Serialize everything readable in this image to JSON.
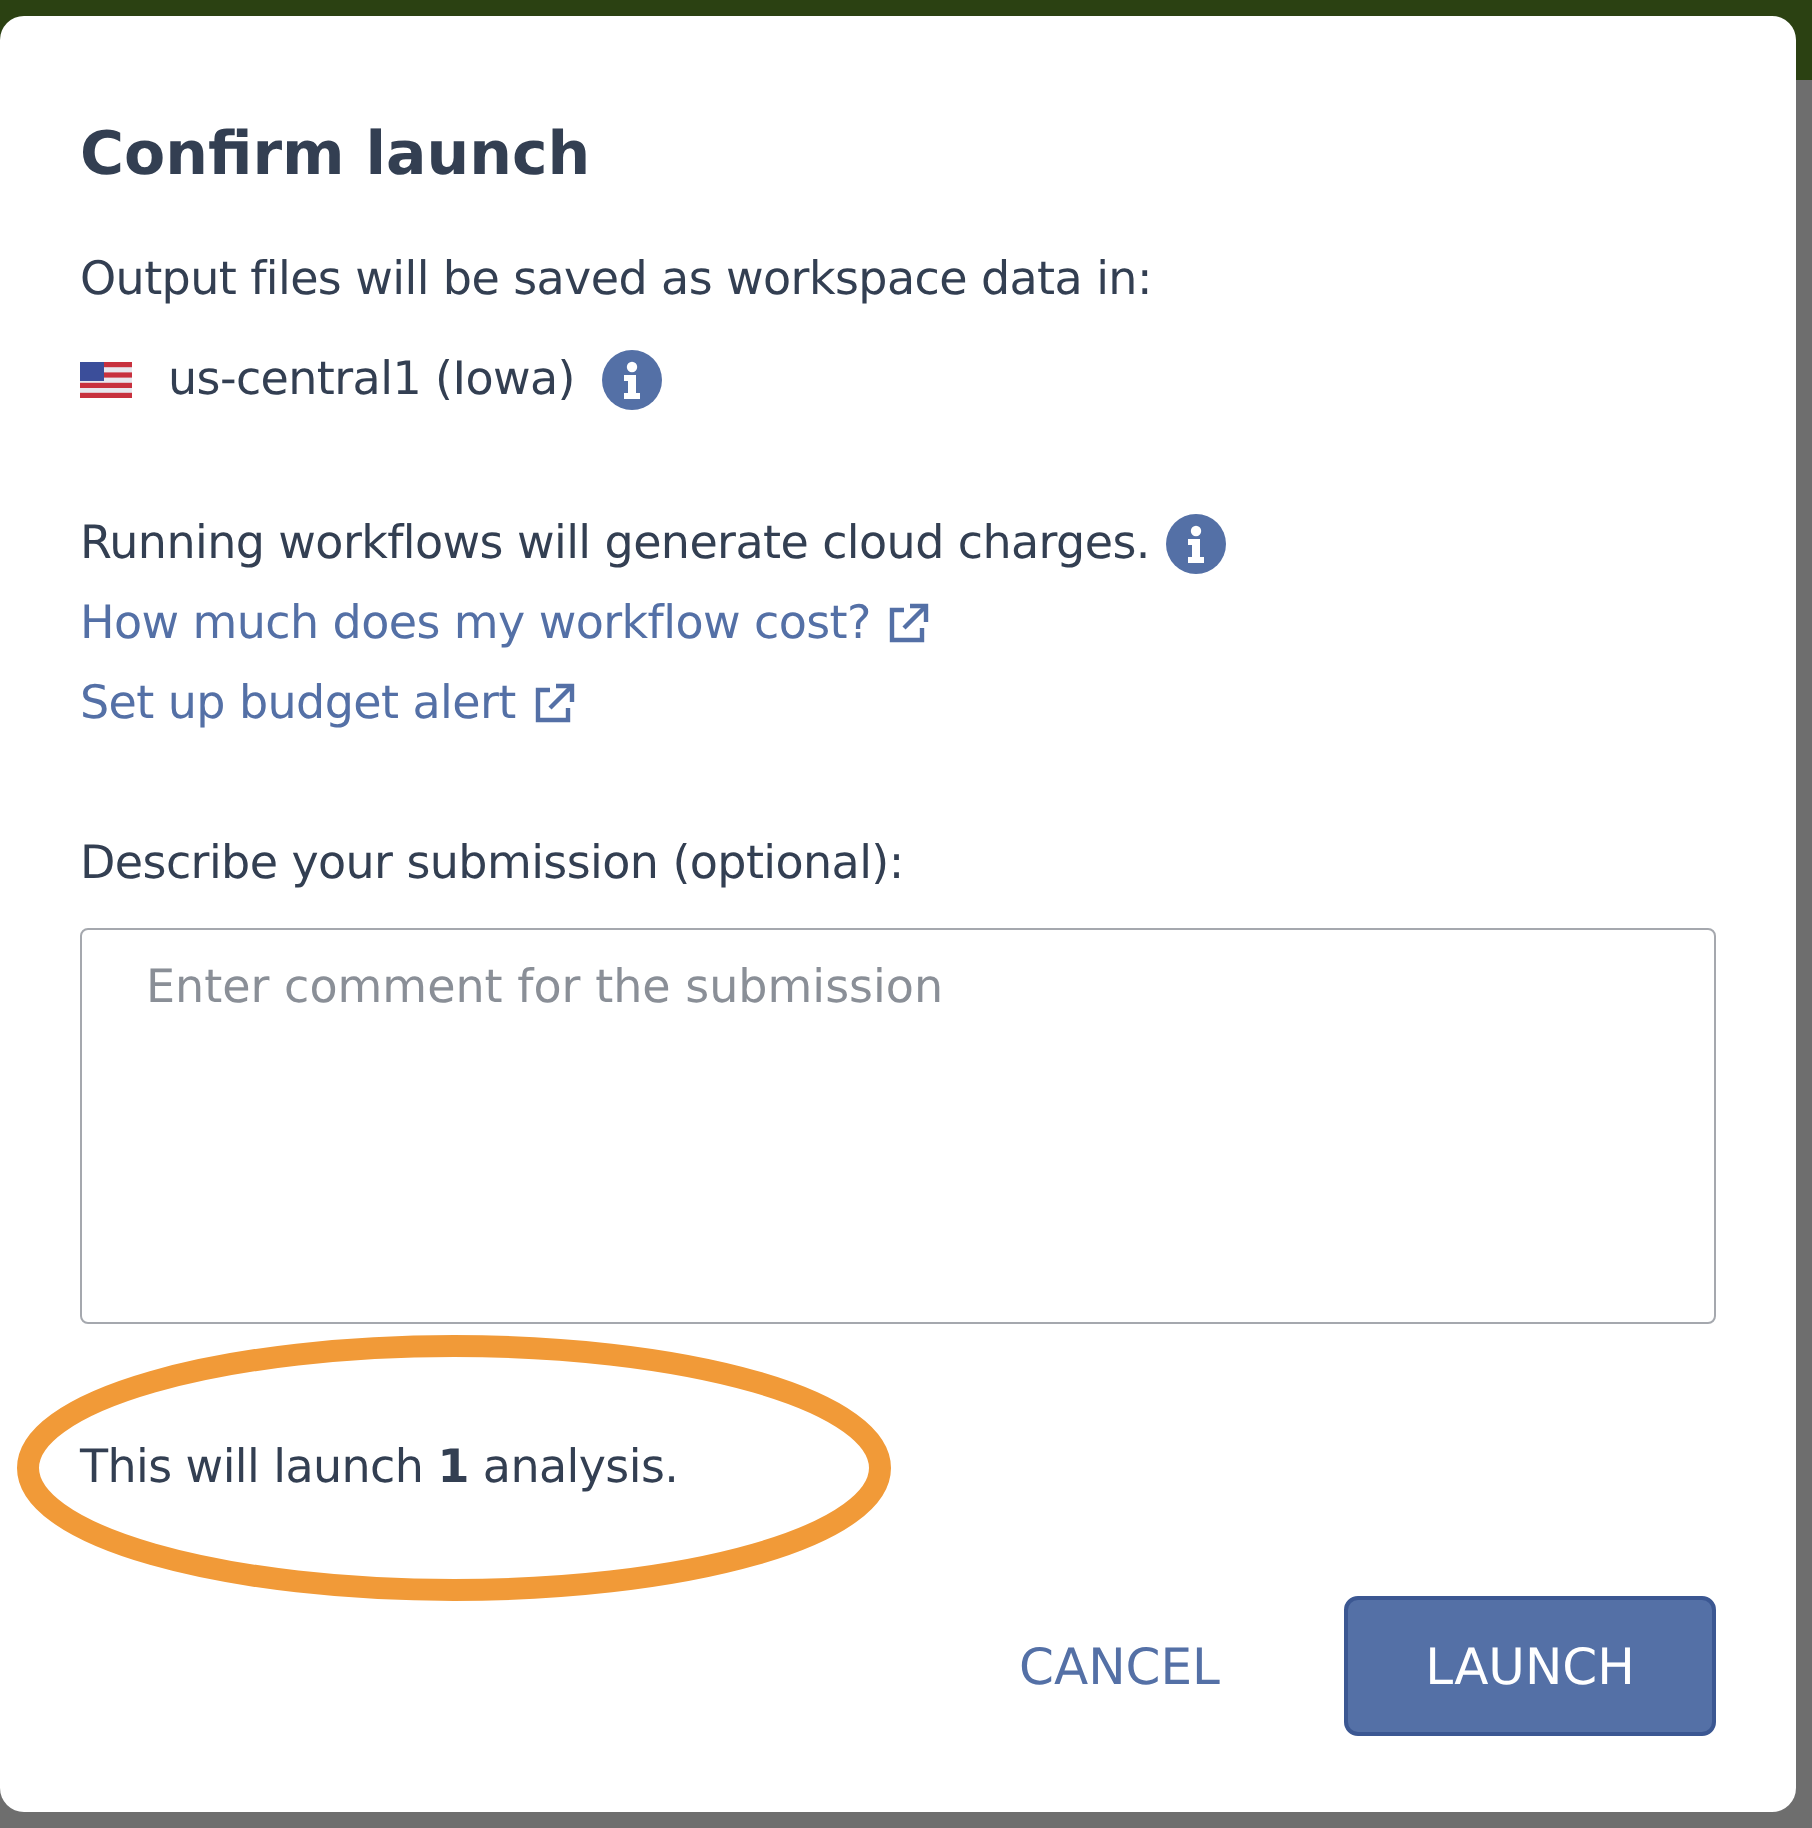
{
  "dialog": {
    "title": "Confirm launch",
    "output_text": "Output files will be saved as workspace data in:",
    "region": "us-central1 (Iowa)",
    "charges_text": "Running workflows will generate cloud charges.",
    "links": [
      {
        "label": "How much does my workflow cost?"
      },
      {
        "label": "Set up budget alert"
      }
    ],
    "description_label": "Describe your submission (optional):",
    "comment": {
      "placeholder": "Enter comment for the submission"
    },
    "summary": "This will launch **1** analysis.",
    "summary_highlighted": true,
    "buttons": [
      {
        "label": "CANCEL",
        "kind": "text"
      },
      {
        "label": "LAUNCH",
        "kind": "primary"
      }
    ]
  }
}
